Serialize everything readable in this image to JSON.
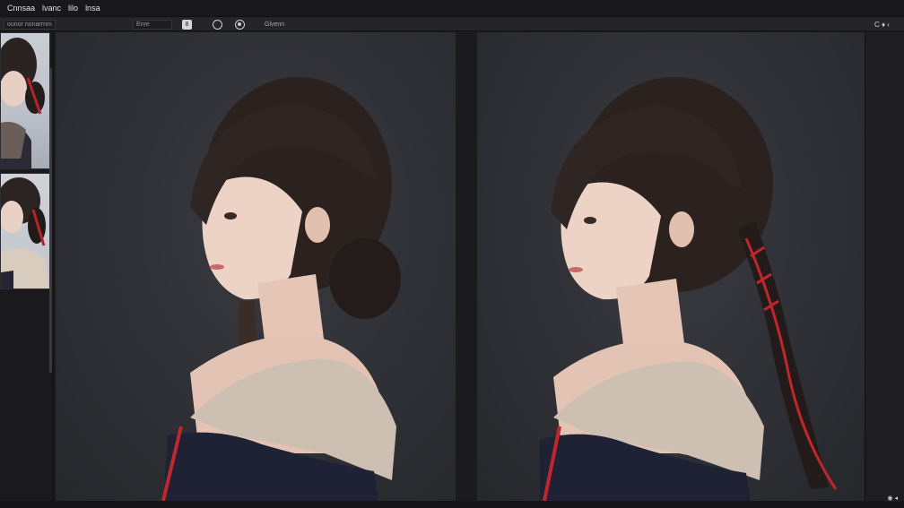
{
  "menubar": {
    "items": [
      "Cnnsaa",
      "lvanc",
      "lilo",
      "lnsa"
    ]
  },
  "toolbar": {
    "field_1": "ounor nonarrnm",
    "field_2": "Enre",
    "button_label": "8",
    "view_label": "Glvenn",
    "right_icons": "C  ♦  ‹"
  },
  "status": {
    "icons": "◉  ◂"
  },
  "colors": {
    "background": "#1c1c1e",
    "panel": "#303136",
    "ribbon": "#c0262c"
  },
  "icons": [
    "circle-icon",
    "target-icon",
    "power-icon",
    "chevron-icon"
  ]
}
